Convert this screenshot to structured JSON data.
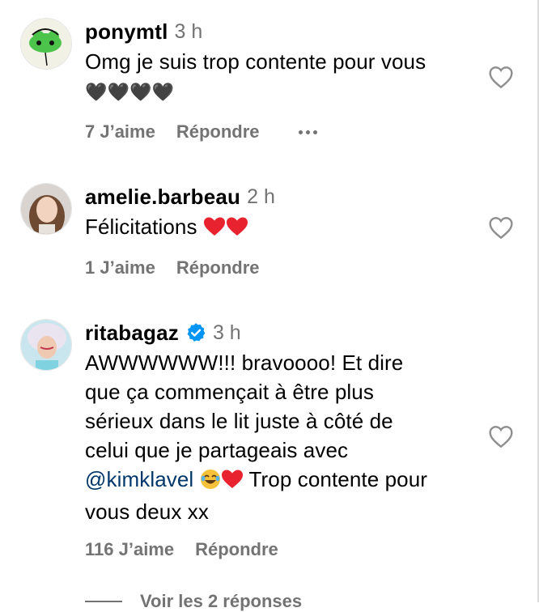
{
  "comments": [
    {
      "username": "ponymtl",
      "time": "3 h",
      "text": "Omg je suis trop contente pour vous",
      "text2": "🖤🖤🖤🖤",
      "likes": "7 J’aime",
      "reply": "Répondre"
    },
    {
      "username": "amelie.barbeau",
      "time": "2 h",
      "text": "Félicitations",
      "likes": "1 J’aime",
      "reply": "Répondre"
    },
    {
      "username": "ritabagaz",
      "time": "3 h",
      "lines": [
        "AWWWWWW!!! bravoooo! Et dire",
        "que ça commençait à être plus",
        "sérieux dans le lit juste à côté de",
        "celui que je partageais avec"
      ],
      "mention": "@kimklavel",
      "after_mention": "Trop contente pour",
      "last_line": "vous deux xx",
      "likes": "116 J’aime",
      "reply": "Répondre"
    }
  ],
  "view_replies": "Voir les 2 réponses",
  "icons": {
    "like": "heart-outline-icon",
    "more": "more-options-icon",
    "verified": "verified-badge-icon"
  },
  "colors": {
    "muted": "#737373",
    "mention": "#00376b",
    "verified": "#0095f6"
  }
}
